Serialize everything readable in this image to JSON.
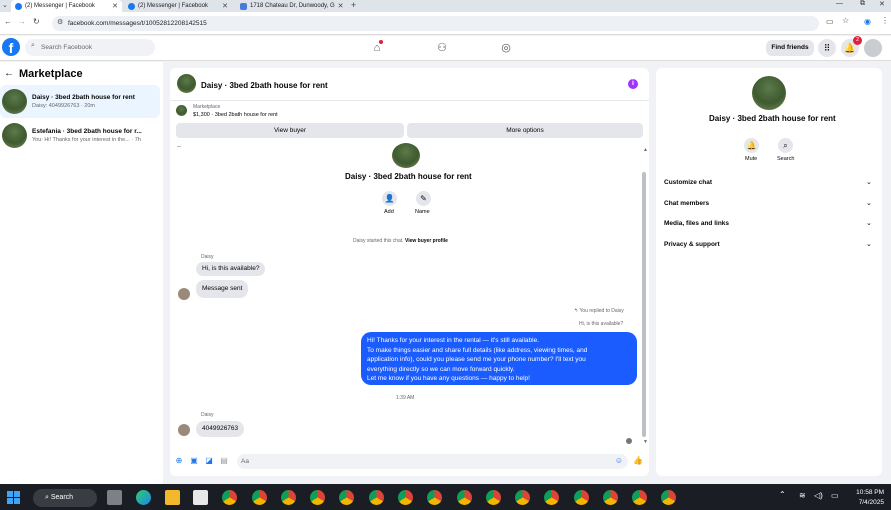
{
  "browser": {
    "tabs": [
      {
        "title": "(2) Messenger | Facebook"
      },
      {
        "title": "(2) Messenger | Facebook"
      },
      {
        "title": "1718 Chateau Dr, Dunwoody, G"
      }
    ],
    "new_tab": "+",
    "url": "facebook.com/messages/t/10052812208142515"
  },
  "fb_nav": {
    "search_placeholder": "Search Facebook",
    "find_friends": "Find friends",
    "notification_count": "2"
  },
  "left_panel": {
    "title": "Marketplace",
    "conversations": [
      {
        "name": "Daisy · 3bed 2bath house for rent",
        "preview": "Daisy: 4049926763 · 20m"
      },
      {
        "name": "Estefania · 3bed 2bath house for r...",
        "preview": "You: Hi! Thanks for your interest in the... · 7h"
      }
    ]
  },
  "chat": {
    "header_title": "Daisy · 3bed 2bath house for rent",
    "listing_source": "Marketplace",
    "listing_info": "$1,300 · 3bed 2bath house for rent",
    "view_buyer": "View buyer",
    "more_options": "More options",
    "intro_title": "Daisy · 3bed 2bath house for rent",
    "add_label": "Add",
    "name_label": "Name",
    "started_text": "Daisy started this chat.",
    "view_profile": "View buyer profile",
    "sender1": "Daisy",
    "msg1": "Hi, is this available?",
    "msg2": "Message sent",
    "replied_label": "You replied to Daisy",
    "replied_quote": "Hi, is this available?",
    "reply_lines": [
      "Hi! Thanks for your interest in the rental — it's still available.",
      "To make things easier and share full details (like address, viewing times, and",
      "application info), could you please send me your phone number? I'll text you",
      "everything directly so we can move forward quickly.",
      "Let me know if you have any questions — happy to help!"
    ],
    "timestamp": "1:39 AM",
    "sender2": "Daisy",
    "msg3": "4049926763",
    "composer_placeholder": "Aa"
  },
  "right_panel": {
    "title": "Daisy · 3bed 2bath house for rent",
    "mute": "Mute",
    "search": "Search",
    "sections": [
      "Customize chat",
      "Chat members",
      "Media, files and links",
      "Privacy & support"
    ]
  },
  "taskbar": {
    "search": "Search",
    "time": "10:58 PM",
    "date": "7/4/2025"
  },
  "colors": {
    "fb_blue": "#1877f2",
    "outgoing_bubble": "#1a5cff",
    "badge_red": "#e41e3f"
  }
}
